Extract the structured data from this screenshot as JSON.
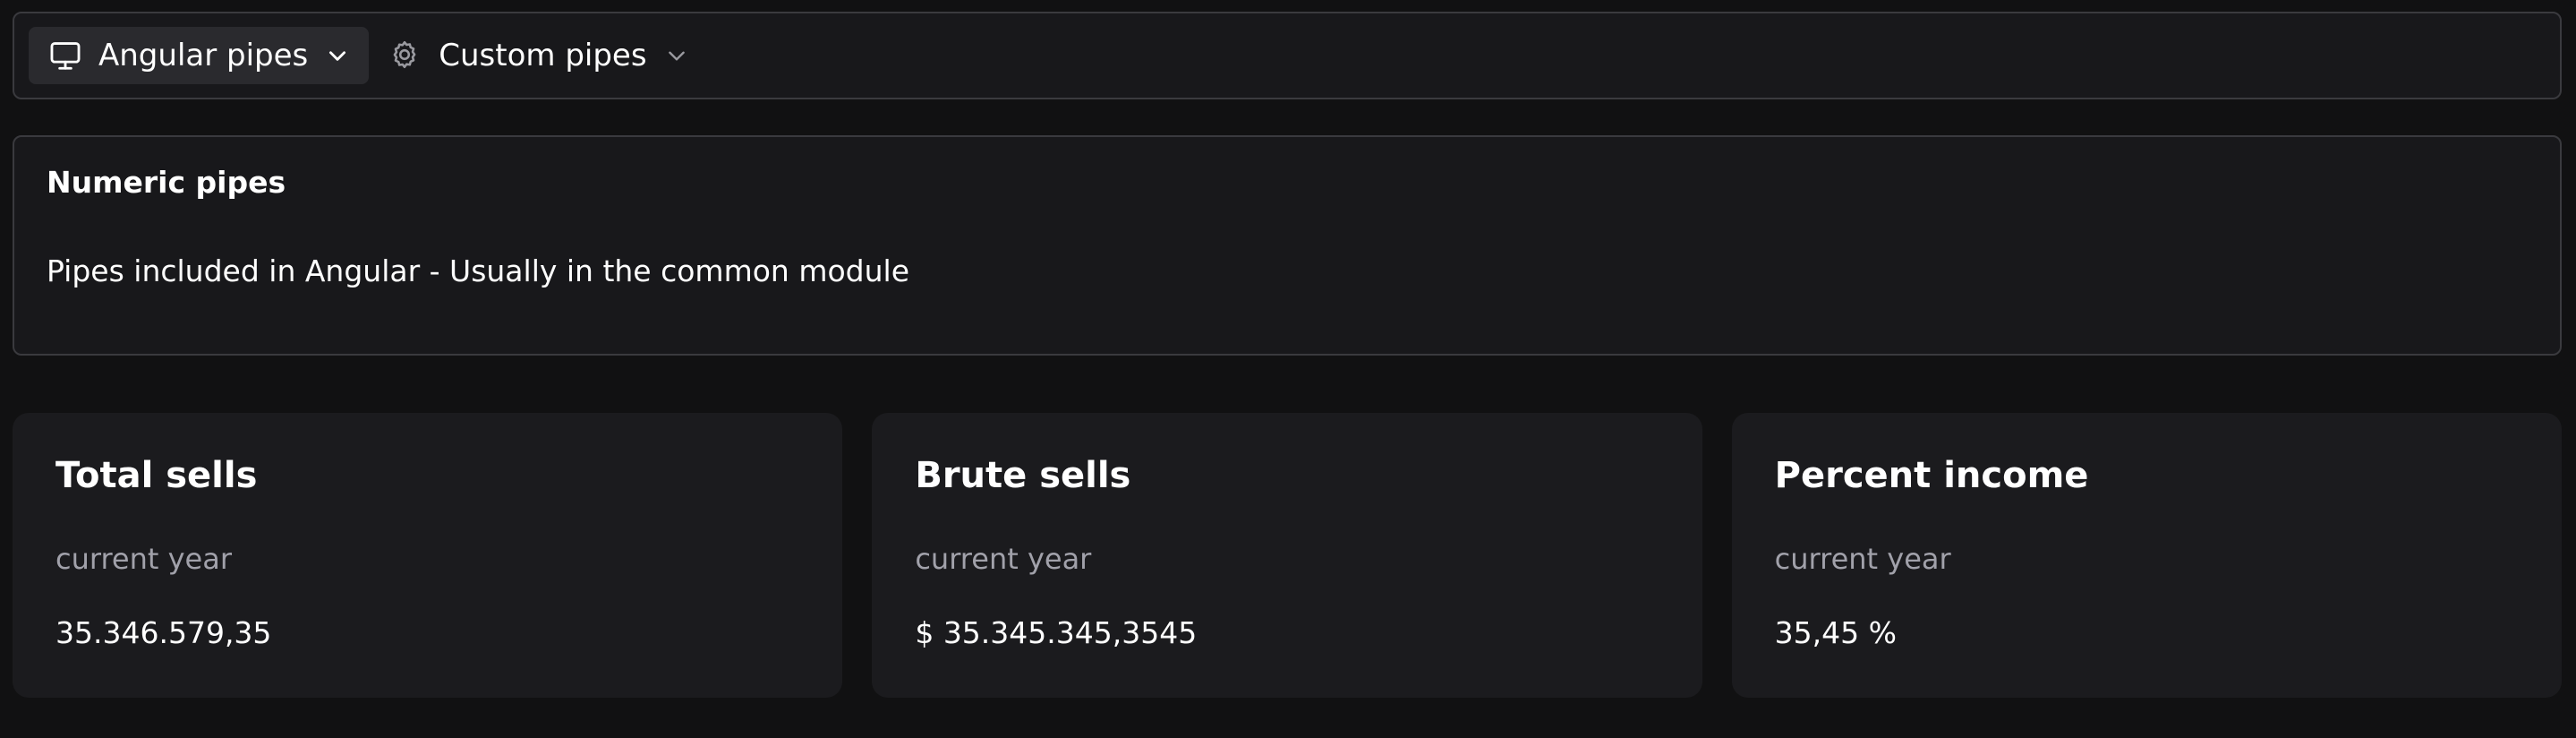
{
  "menubar": {
    "items": [
      {
        "label": "Angular pipes",
        "icon": "monitor-icon",
        "active": true
      },
      {
        "label": "Custom pipes",
        "icon": "gear-icon",
        "active": false
      }
    ]
  },
  "panel": {
    "title": "Numeric pipes",
    "body": "Pipes included in Angular - Usually in the common module"
  },
  "cards": [
    {
      "title": "Total sells",
      "subtitle": "current year",
      "value": "35.346.579,35"
    },
    {
      "title": "Brute sells",
      "subtitle": "current year",
      "value": "$ 35.345.345,3545"
    },
    {
      "title": "Percent income",
      "subtitle": "current year",
      "value": "35,45 %"
    }
  ],
  "colors": {
    "background": "#111112",
    "surface": "#18181b",
    "border": "#3a3a3e",
    "muted_text": "#a1a1aa"
  }
}
